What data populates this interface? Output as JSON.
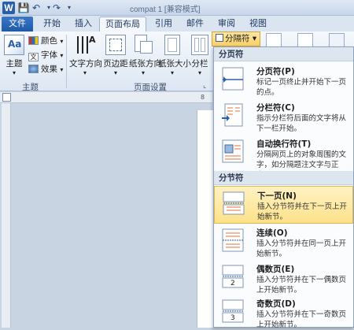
{
  "titlebar": {
    "app_icon": "W",
    "doc_title": "compat 1 [兼容模式]"
  },
  "tabs": [
    "文件",
    "开始",
    "插入",
    "页面布局",
    "引用",
    "邮件",
    "审阅",
    "视图"
  ],
  "ribbon": {
    "theme_label": "主题",
    "colors_label": "颜色",
    "fonts_label": "字体",
    "effects_label": "效果",
    "text_direction_label": "文字方向",
    "margins_label": "页边距",
    "orientation_label": "纸张方向",
    "size_label": "纸张大小",
    "columns_label": "分栏",
    "group_theme": "主题",
    "group_page_setup": "页面设置"
  },
  "breaks_button": {
    "label": "分隔符",
    "arrow": "▾"
  },
  "menu": {
    "section_page_breaks": "分页符",
    "section_section_breaks": "分节符",
    "items": [
      {
        "title": "分页符(P)",
        "desc": "标记一页终止并开始下一页的点。"
      },
      {
        "title": "分栏符(C)",
        "desc": "指示分栏符后面的文字将从下一栏开始。"
      },
      {
        "title": "自动换行符(T)",
        "desc": "分隔网页上的对象周围的文字，如分隔题注文字与正文。"
      },
      {
        "title": "下一页(N)",
        "desc": "插入分节符并在下一页上开始新节。"
      },
      {
        "title": "连续(O)",
        "desc": "插入分节符并在同一页上开始新节。"
      },
      {
        "title": "偶数页(E)",
        "desc": "插入分节符并在下一偶数页上开始新节。"
      },
      {
        "title": "奇数页(D)",
        "desc": "插入分节符并在下一奇数页上开始新节。"
      }
    ]
  },
  "ruler": {
    "mark": "8"
  }
}
